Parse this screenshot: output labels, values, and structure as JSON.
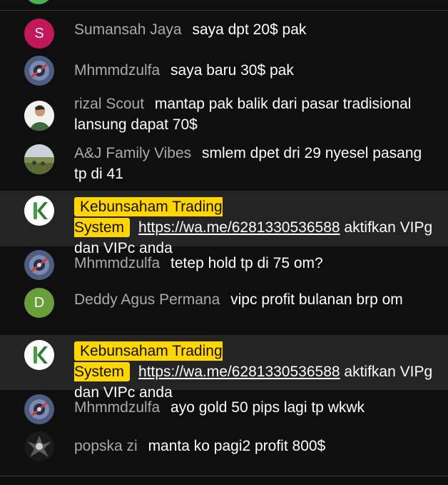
{
  "messages": [
    {
      "author": "Sumansah Jaya",
      "text": "saya dpt 20$ pak",
      "avatar": {
        "type": "letter",
        "letter": "S",
        "color": "#c2185b"
      }
    },
    {
      "author": "Mhmmdzulfa",
      "text": "saya baru 30$ pak",
      "avatar": {
        "type": "image",
        "icon": "round-photo-icon"
      }
    },
    {
      "author": "rizal Scout",
      "text": "mantap pak balik dari pasar tradisional lansung dapat 70$",
      "avatar": {
        "type": "image",
        "icon": "person-photo-icon"
      }
    },
    {
      "author": "A&J Family Vibes",
      "text": "smlem dpet dri 29 nyesel pasang tp di 41",
      "avatar": {
        "type": "image",
        "icon": "landscape-photo-icon"
      }
    },
    {
      "author": "Kebunsaham Trading System",
      "owner": true,
      "link": "https://wa.me/6281330536588",
      "text": " aktifkan VIPg dan VIPc anda",
      "avatar": {
        "type": "logo",
        "letter": "K",
        "color": "#2e7d32"
      }
    },
    {
      "author": "Mhmmdzulfa",
      "text": "tetep hold tp di 75 om?",
      "avatar": {
        "type": "image",
        "icon": "round-photo-icon"
      }
    },
    {
      "author": "Deddy Agus Permana",
      "text": "vipc profit bulanan brp om",
      "avatar": {
        "type": "letter",
        "letter": "D",
        "color": "#689f38"
      }
    },
    {
      "author": "Kebunsaham Trading System",
      "owner": true,
      "link": "https://wa.me/6281330536588",
      "text": " aktifkan VIPg dan VIPc anda",
      "avatar": {
        "type": "logo",
        "letter": "K",
        "color": "#2e7d32"
      }
    },
    {
      "author": "Mhmmdzulfa",
      "text": "ayo gold 50 pips lagi tp wkwk",
      "avatar": {
        "type": "image",
        "icon": "round-photo-icon"
      }
    },
    {
      "author": "popska zi",
      "text": "manta ko pagi2 profit 800$",
      "avatar": {
        "type": "image",
        "icon": "dark-figure-icon"
      }
    }
  ]
}
